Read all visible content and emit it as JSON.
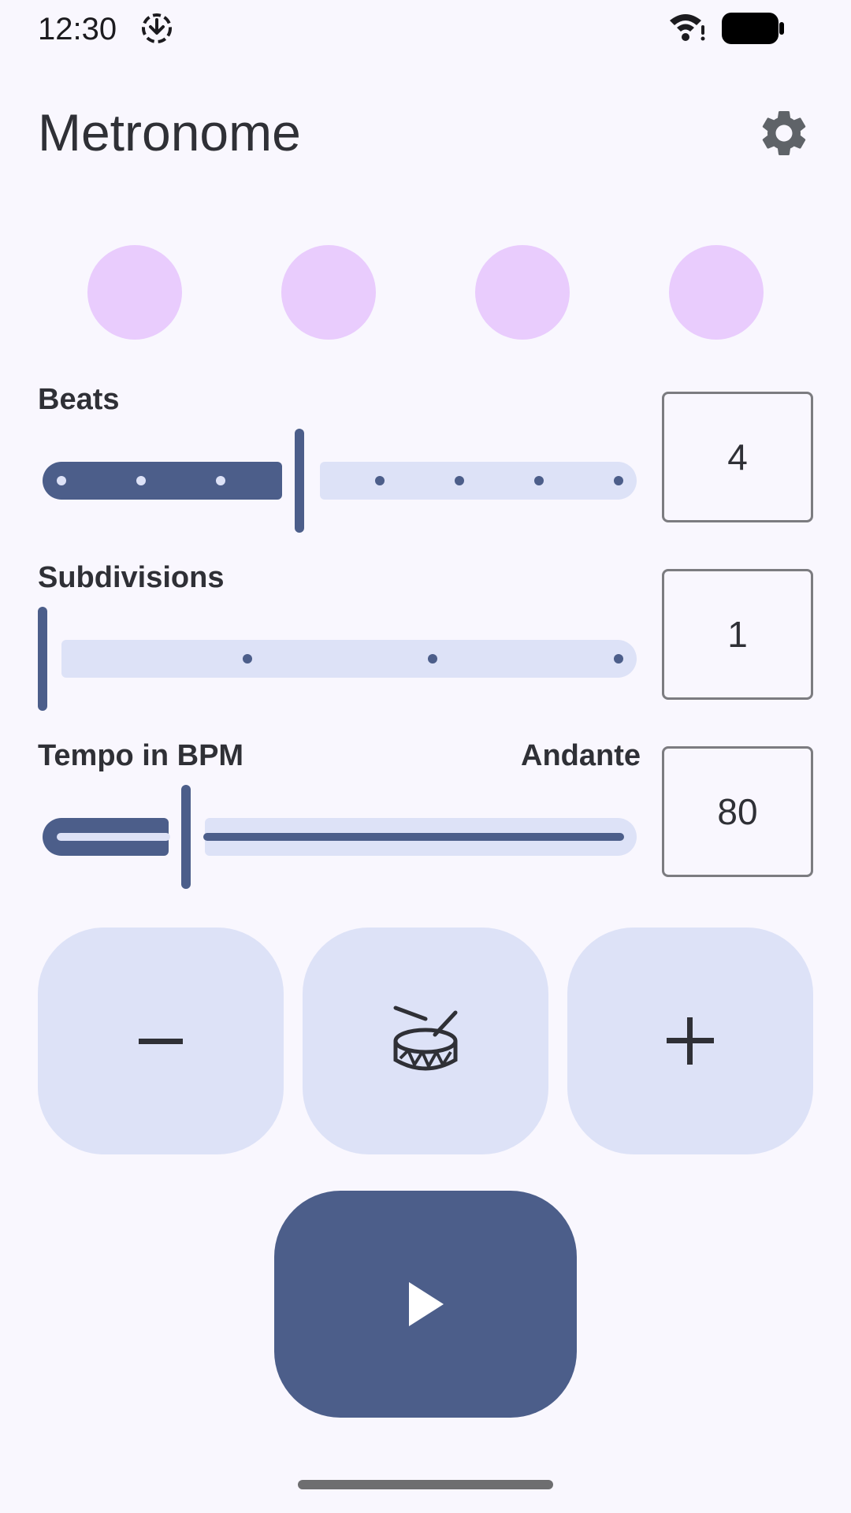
{
  "status_bar": {
    "time": "12:30",
    "icons": [
      "download-icon",
      "wifi-icon",
      "battery-icon"
    ]
  },
  "header": {
    "title": "Metronome",
    "settings_icon": "gear-icon"
  },
  "beat_indicators": {
    "count": 4,
    "color": "#E9CCFD"
  },
  "beats": {
    "label": "Beats",
    "value": "4",
    "slider_fraction": 0.375
  },
  "subdivisions": {
    "label": "Subdivisions",
    "value": "1",
    "slider_fraction": 0.0
  },
  "tempo": {
    "label": "Tempo in BPM",
    "marking": "Andante",
    "value": "80",
    "slider_fraction": 0.24
  },
  "controls": {
    "decrease_icon": "minus-icon",
    "tap_icon": "drum-icon",
    "increase_icon": "plus-icon",
    "play_icon": "play-icon"
  },
  "colors": {
    "primary": "#4C5E8A",
    "tonal": "#DDE2F7",
    "background": "#F9F7FE"
  }
}
